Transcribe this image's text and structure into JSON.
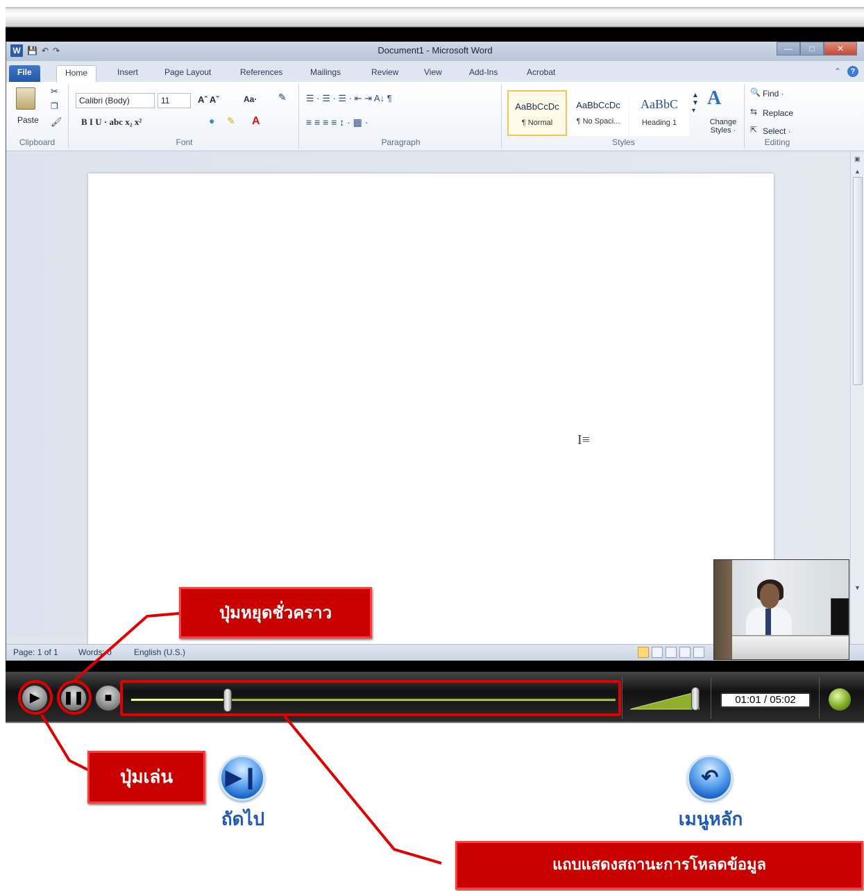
{
  "word": {
    "window_title": "Document1 - Microsoft Word",
    "qat_logo": "W",
    "tabs": [
      "File",
      "Home",
      "Insert",
      "Page Layout",
      "References",
      "Mailings",
      "Review",
      "View",
      "Add-Ins",
      "Acrobat"
    ],
    "ribbon": {
      "clipboard": {
        "paste": "Paste",
        "label": "Clipboard"
      },
      "font": {
        "font_name": "Calibri (Body)",
        "font_size": "11",
        "label": "Font",
        "row2": "B  I  U  · abc  x₂  x²",
        "grow": "Aˆ Aˇ",
        "case": "Aa·",
        "color": "A"
      },
      "paragraph": {
        "label": "Paragraph",
        "row1": "☰ · ☰ · ☰ ·  ⇤ ⇥  A↓  ¶",
        "row2": "≡ ≡ ≡ ≡  ↕ ·  ▦ ·"
      },
      "styles": {
        "label": "Styles",
        "tiles": [
          {
            "sample": "AaBbCcDc",
            "name": "¶ Normal"
          },
          {
            "sample": "AaBbCcDc",
            "name": "¶ No Spaci..."
          },
          {
            "sample": "AaBbC",
            "name": "Heading 1"
          }
        ],
        "change_styles": "Change Styles ·"
      },
      "editing": {
        "label": "Editing",
        "find": "Find ·",
        "replace": "Replace",
        "select": "Select ·"
      }
    },
    "status": {
      "page": "Page: 1 of 1",
      "words": "Words: 0",
      "language": "English (U.S.)"
    }
  },
  "player": {
    "time": "01:01 / 05:02",
    "progress_fraction": 0.2
  },
  "callouts": {
    "pause": "ปุ่มหยุดชั่วคราว",
    "play": "ปุ่มเล่น",
    "loadbar": "แถบแสดงสถานะการโหลดข้อมูล"
  },
  "nav": {
    "next": "ถัดไป",
    "main_menu": "เมนูหลัก"
  },
  "colors": {
    "callout_red": "#c90000",
    "highlight_red": "#e10000",
    "nav_blue": "#1f58b6",
    "progress_green": "#c7d56a"
  }
}
